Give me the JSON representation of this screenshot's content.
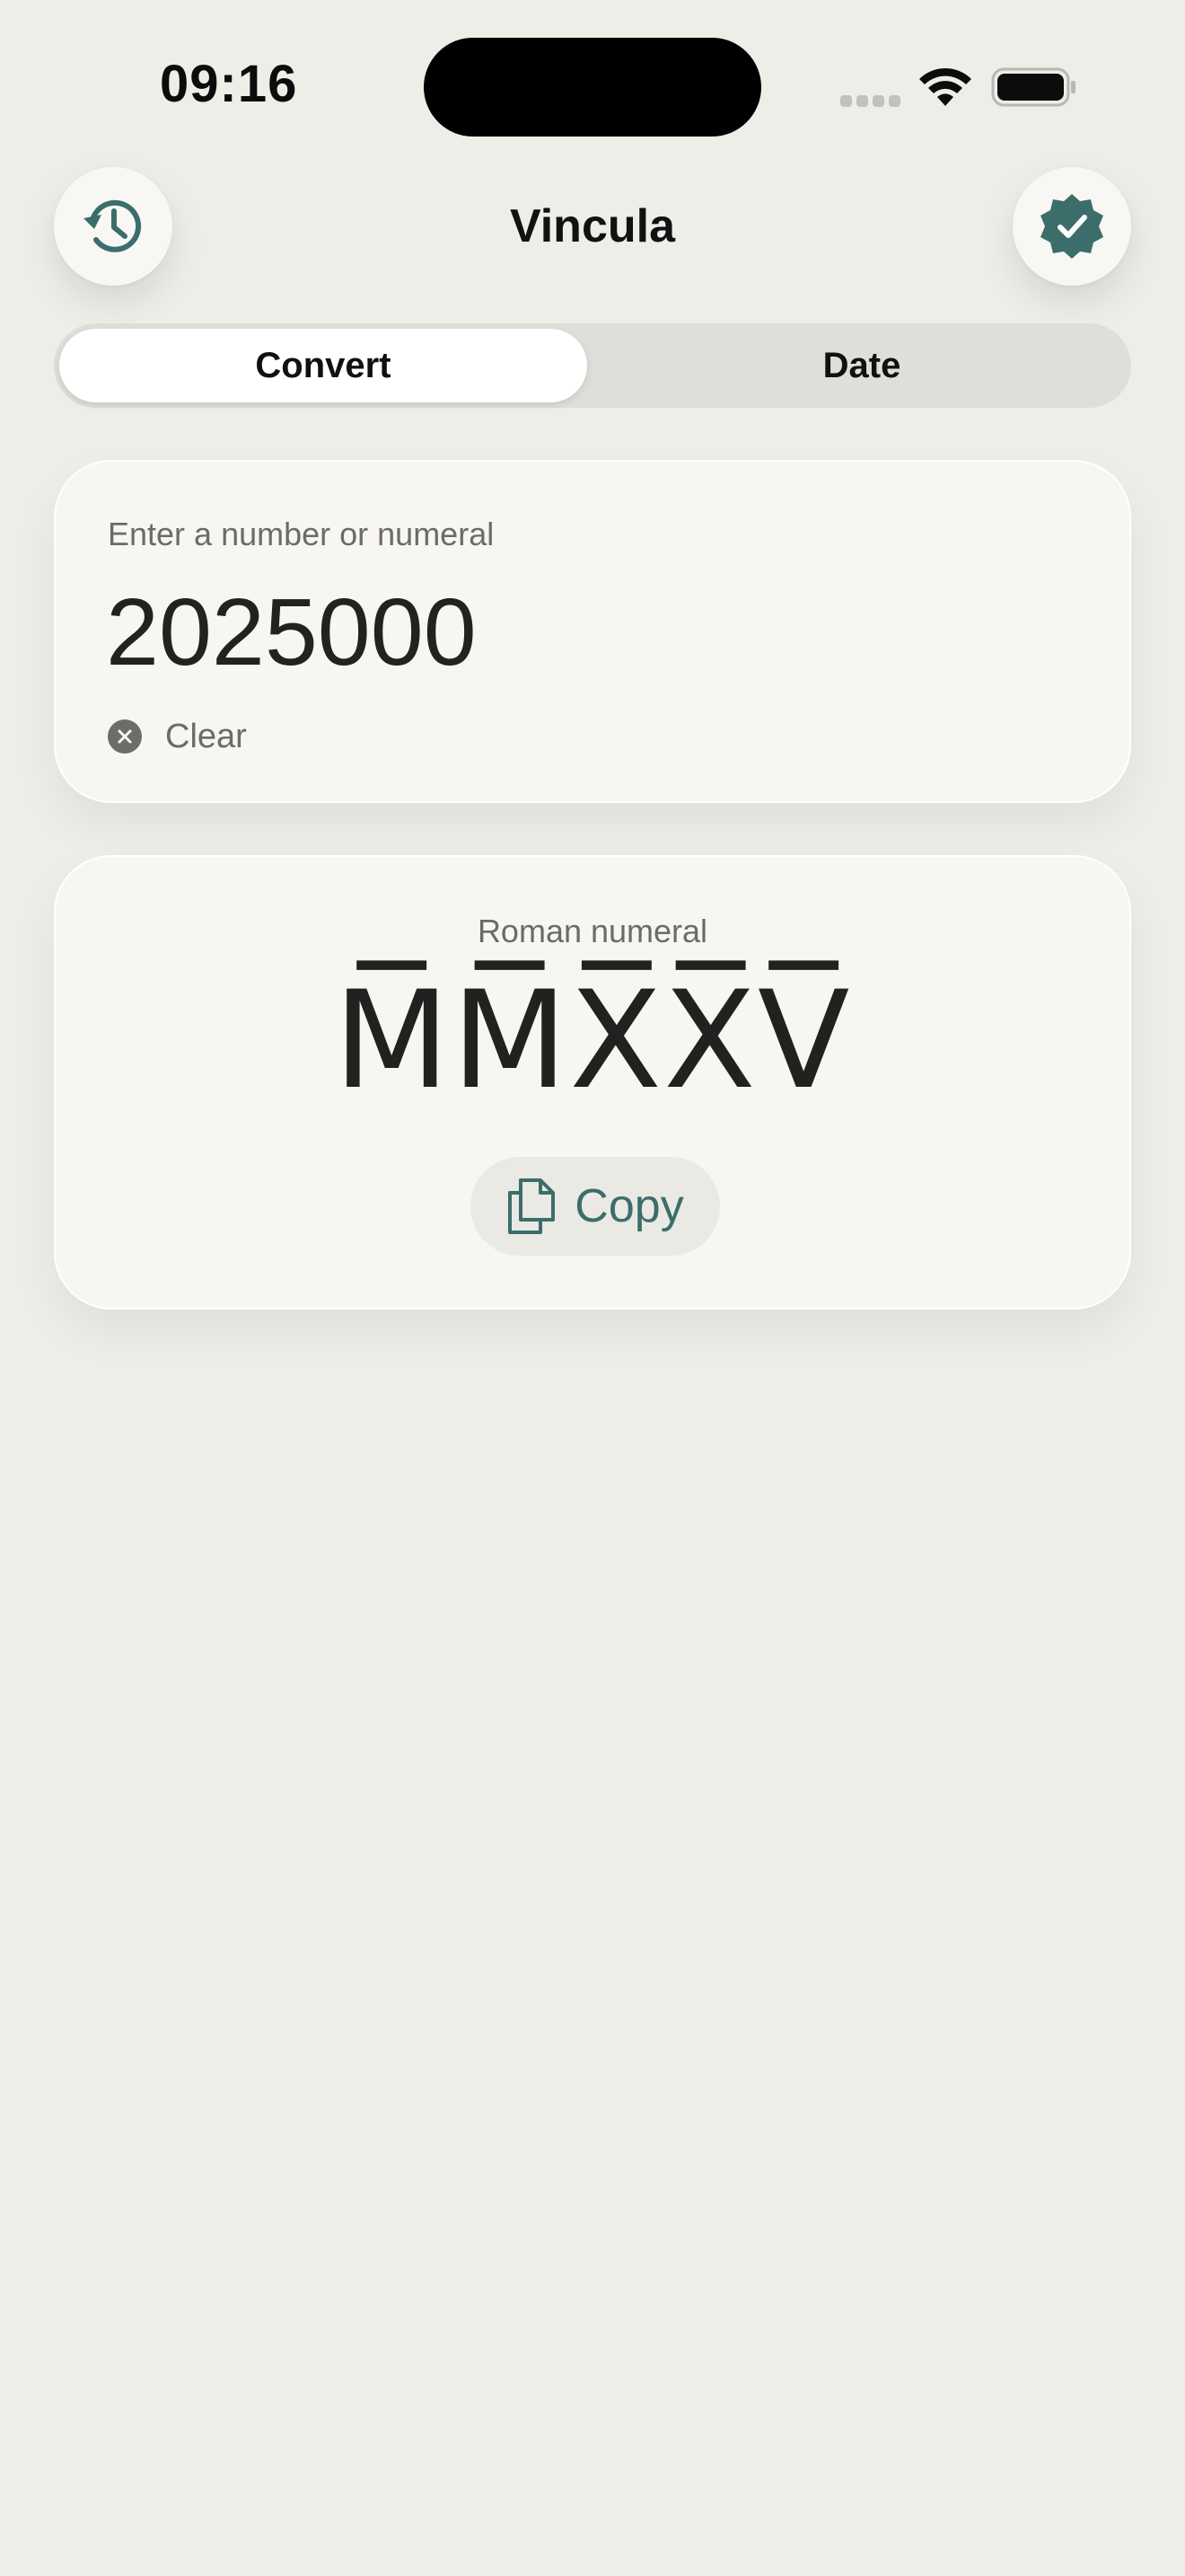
{
  "status_bar": {
    "time": "09:16"
  },
  "header": {
    "title": "Vincula",
    "history_icon": "history-clock-icon",
    "verified_icon": "verified-badge-icon"
  },
  "segmented": {
    "tabs": [
      {
        "label": "Convert",
        "selected": true
      },
      {
        "label": "Date",
        "selected": false
      }
    ]
  },
  "input_card": {
    "label": "Enter a number or numeral",
    "value": "2025000",
    "clear_label": "Clear"
  },
  "result_card": {
    "label": "Roman numeral",
    "numeral": "M̅M̅X̅X̅V̅",
    "copy_label": "Copy"
  },
  "colors": {
    "accent": "#3B6E6B",
    "background": "#EFEDE8",
    "card": "#F7F6F2"
  }
}
